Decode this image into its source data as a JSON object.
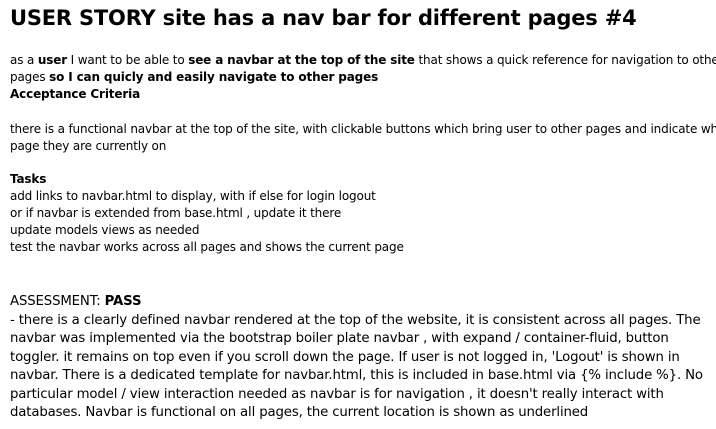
{
  "title": "USER STORY site has a nav bar for different pages #4",
  "story": {
    "s1": "as a ",
    "s2": "user",
    "s3": " I want to be able to ",
    "s4": "see a navbar at the top of the site",
    "s5": " that shows a quick reference for navigation to other",
    "s6": "pages ",
    "s7": "so I can quicly and easily navigate to other pages"
  },
  "acceptance_heading": "Acceptance Criteria",
  "acceptance_lines": [
    "there is a functional navbar at the top of the site, with clickable buttons which bring user to other pages and indicate what",
    "page they are currently on"
  ],
  "tasks_heading": "Tasks",
  "tasks": [
    "add links to navbar.html to display, with if else for login logout",
    "or if navbar is extended from base.html , update it there",
    "update models views as needed",
    "test the navbar works across all pages and shows the current page"
  ],
  "assessment_label": "ASSESSMENT: ",
  "assessment_result": "PASS",
  "assessment_lines": [
    " - there is a clearly defined navbar rendered at the top of the website, it is consistent across all pages. The",
    "navbar was implemented via the bootstrap boiler plate navbar , with expand / container-fluid, button",
    "toggler. it remains on top even if you scroll down the page. If user is not logged in, 'Logout' is shown in",
    "navbar. There is a dedicated template for navbar.html, this is included in base.html via {% include %}. No",
    "particular model / view interaction needed as navbar is for navigation , it doesn't really interact with",
    "databases. Navbar is functional on all pages, the current location is shown as underlined"
  ]
}
